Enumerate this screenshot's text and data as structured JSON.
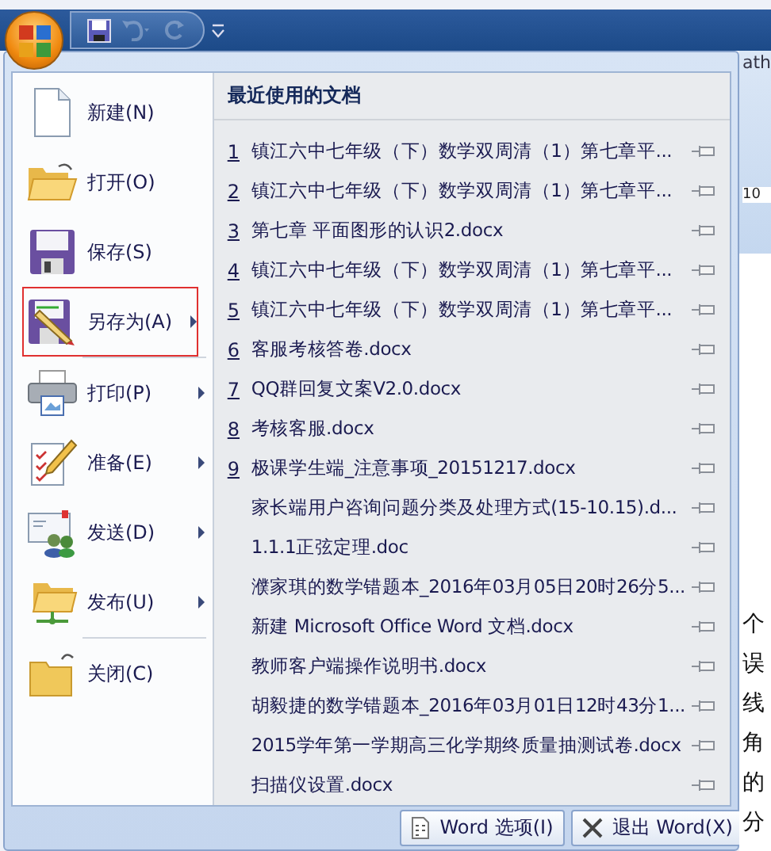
{
  "quick_access": {
    "undo_disabled": true,
    "redo_disabled": true
  },
  "menu_items": [
    {
      "kind": "new",
      "label": "新建(N)",
      "has_submenu": false,
      "highlighted": false,
      "divider_after": false
    },
    {
      "kind": "open",
      "label": "打开(O)",
      "has_submenu": false,
      "highlighted": false,
      "divider_after": false
    },
    {
      "kind": "save",
      "label": "保存(S)",
      "has_submenu": false,
      "highlighted": false,
      "divider_after": false
    },
    {
      "kind": "saveas",
      "label": "另存为(A)",
      "has_submenu": true,
      "highlighted": true,
      "divider_after": true
    },
    {
      "kind": "print",
      "label": "打印(P)",
      "has_submenu": true,
      "highlighted": false,
      "divider_after": false
    },
    {
      "kind": "prepare",
      "label": "准备(E)",
      "has_submenu": true,
      "highlighted": false,
      "divider_after": false
    },
    {
      "kind": "send",
      "label": "发送(D)",
      "has_submenu": true,
      "highlighted": false,
      "divider_after": false
    },
    {
      "kind": "publish",
      "label": "发布(U)",
      "has_submenu": true,
      "highlighted": false,
      "divider_after": true
    },
    {
      "kind": "close",
      "label": "关闭(C)",
      "has_submenu": false,
      "highlighted": false,
      "divider_after": false
    }
  ],
  "recent": {
    "title": "最近使用的文档",
    "items": [
      {
        "number": "1",
        "name": "镇江六中七年级（下）数学双周清（1）第七章平..."
      },
      {
        "number": "2",
        "name": "镇江六中七年级（下）数学双周清（1）第七章平..."
      },
      {
        "number": "3",
        "name": "第七章 平面图形的认识2.docx"
      },
      {
        "number": "4",
        "name": "镇江六中七年级（下）数学双周清（1）第七章平..."
      },
      {
        "number": "5",
        "name": "镇江六中七年级（下）数学双周清（1）第七章平..."
      },
      {
        "number": "6",
        "name": "客服考核答卷.docx"
      },
      {
        "number": "7",
        "name": "QQ群回复文案V2.0.docx"
      },
      {
        "number": "8",
        "name": "考核客服.docx"
      },
      {
        "number": "9",
        "name": "极课学生端_注意事项_20151217.docx"
      },
      {
        "name": "家长端用户咨询问题分类及处理方式(15-10.15).d..."
      },
      {
        "name": "1.1.1正弦定理.doc"
      },
      {
        "name": "濮家琪的数学错题本_2016年03月05日20时26分5..."
      },
      {
        "name": "新建 Microsoft Office Word 文档.docx"
      },
      {
        "name": "教师客户端操作说明书.docx"
      },
      {
        "name": "胡毅捷的数学错题本_2016年03月01日12时43分1..."
      },
      {
        "name": "2015学年第一学期高三化学期终质量抽测试卷.docx"
      },
      {
        "name": "扫描仪设置.docx"
      }
    ]
  },
  "footer_buttons": [
    {
      "kind": "options",
      "label": "Word 选项(I)"
    },
    {
      "kind": "exit",
      "label": "退出 Word(X)"
    }
  ],
  "background": {
    "ribbon_text": "ath",
    "ribbon_field": "10",
    "document_fragments": [
      "个",
      "误",
      "线",
      "角",
      "的",
      "分"
    ]
  }
}
